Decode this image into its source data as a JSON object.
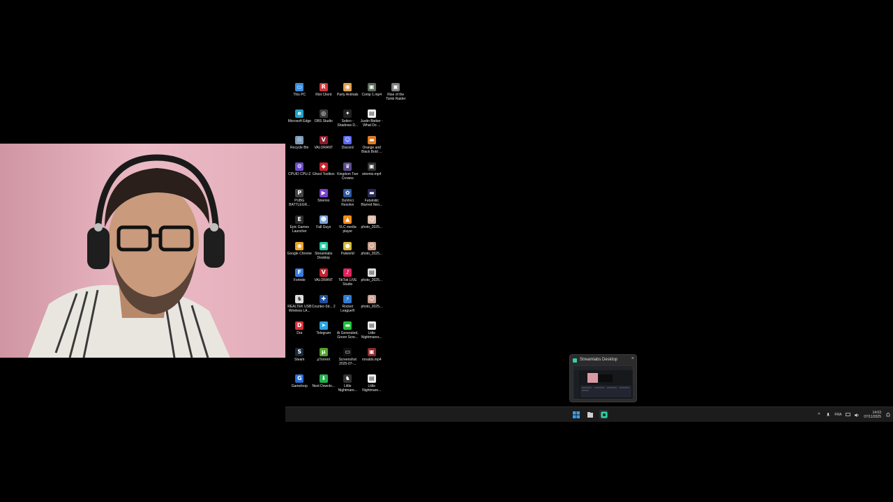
{
  "desktop": {
    "icons": [
      {
        "label": "This PC",
        "color": "#3b8fe0",
        "glyph": "▭"
      },
      {
        "label": "Riot Client",
        "color": "#d13639",
        "glyph": "R"
      },
      {
        "label": "Party Animals",
        "color": "#e0a050",
        "glyph": "◉"
      },
      {
        "label": "Comp 1.mp4",
        "color": "#5a6a5a",
        "glyph": "▣"
      },
      {
        "label": "Rise of the Tomb Raider",
        "color": "#7d7d7d",
        "glyph": "▣"
      },
      {
        "label": "Microsoft Edge",
        "color": "#1fa0c9",
        "glyph": "e"
      },
      {
        "label": "OBS Studio",
        "color": "#3a3a3a",
        "glyph": "◎"
      },
      {
        "label": "Sekiro - Shadows D...",
        "color": "#222",
        "glyph": "✦"
      },
      {
        "label": "Justin Bieber - What Do ...",
        "color": "#eeeeee",
        "glyph": "▤"
      },
      {
        "label": "",
        "color": "transparent",
        "glyph": ""
      },
      {
        "label": "Recycle Bin",
        "color": "#7f9bb8",
        "glyph": "♲"
      },
      {
        "label": "VALORANT",
        "color": "#8b1e2a",
        "glyph": "V"
      },
      {
        "label": "Discord",
        "color": "#5865f2",
        "glyph": "☺"
      },
      {
        "label": "Orange and Black Bold ...",
        "color": "#e07a1f",
        "glyph": "▬"
      },
      {
        "label": "",
        "color": "transparent",
        "glyph": ""
      },
      {
        "label": "CPUID CPU-Z",
        "color": "#6a4cc2",
        "glyph": "⚙"
      },
      {
        "label": "Ghost Toolbox",
        "color": "#c8222c",
        "glyph": "◆"
      },
      {
        "label": "Kingdom Two Crowns",
        "color": "#5a4a8a",
        "glyph": "♛"
      },
      {
        "label": "stremio.mp4",
        "color": "#333",
        "glyph": "▣"
      },
      {
        "label": "",
        "color": "transparent",
        "glyph": ""
      },
      {
        "label": "PUBG BATTLEGR...",
        "color": "#444",
        "glyph": "P"
      },
      {
        "label": "Stremio",
        "color": "#7b3fd1",
        "glyph": "▶"
      },
      {
        "label": "DaVinci Resolve",
        "color": "#2c5aa0",
        "glyph": "✿"
      },
      {
        "label": "Futuristic Blurred Neo...",
        "color": "#2a2a55",
        "glyph": "▬"
      },
      {
        "label": "",
        "color": "transparent",
        "glyph": ""
      },
      {
        "label": "Epic Games Launcher",
        "color": "#2a2a2a",
        "glyph": "E"
      },
      {
        "label": "Fall Guys",
        "color": "#7aa0d8",
        "glyph": "☻"
      },
      {
        "label": "VLC media player",
        "color": "#f28c1e",
        "glyph": "▲"
      },
      {
        "label": "photo_2025...",
        "color": "#d9b9a5",
        "glyph": "☺"
      },
      {
        "label": "",
        "color": "transparent",
        "glyph": ""
      },
      {
        "label": "Google Chrome",
        "color": "#e9a326",
        "glyph": "◉"
      },
      {
        "label": "Streamlabs Desktop",
        "color": "#23c7a0",
        "glyph": "▣"
      },
      {
        "label": "Palworld",
        "color": "#d6b73a",
        "glyph": "●"
      },
      {
        "label": "photo_2025...",
        "color": "#c99b88",
        "glyph": "☺"
      },
      {
        "label": "",
        "color": "transparent",
        "glyph": ""
      },
      {
        "label": "Fortnite",
        "color": "#3a7be0",
        "glyph": "F"
      },
      {
        "label": "VALORANT",
        "color": "#c4232f",
        "glyph": "V"
      },
      {
        "label": "TikTok LIVE Studio",
        "color": "#e0245e",
        "glyph": "♪"
      },
      {
        "label": "photo_2025...",
        "color": "#dddddd",
        "glyph": "▤"
      },
      {
        "label": "",
        "color": "transparent",
        "glyph": ""
      },
      {
        "label": "REALTEK USB Wireless LA...",
        "color": "#dddddd",
        "glyph": "♞"
      },
      {
        "label": "Counter-Str... 2",
        "color": "#1f4f9c",
        "glyph": "✚"
      },
      {
        "label": "Rocket League®",
        "color": "#2f7bd1",
        "glyph": "⚡"
      },
      {
        "label": "photo_2025...",
        "color": "#c79c8c",
        "glyph": "☺"
      },
      {
        "label": "",
        "color": "transparent",
        "glyph": ""
      },
      {
        "label": "Dra",
        "color": "#d8323a",
        "glyph": "D"
      },
      {
        "label": "Telegram",
        "color": "#2aa3e0",
        "glyph": "➤"
      },
      {
        "label": "Ai Generated, Green Scre...",
        "color": "#1fbf3a",
        "glyph": "▬"
      },
      {
        "label": "Little Nightmares...",
        "color": "#eeeeee",
        "glyph": "▤"
      },
      {
        "label": "",
        "color": "transparent",
        "glyph": ""
      },
      {
        "label": "Steam",
        "color": "#1b2838",
        "glyph": "S"
      },
      {
        "label": "µTorrent",
        "color": "#4fa52a",
        "glyph": "µ"
      },
      {
        "label": "Screenshot 2025-07-...",
        "color": "#111",
        "glyph": "▭"
      },
      {
        "label": "ronaldo.mp4",
        "color": "#8a2a2a",
        "glyph": "▣"
      },
      {
        "label": "",
        "color": "transparent",
        "glyph": ""
      },
      {
        "label": "Gameloop",
        "color": "#2a6fd8",
        "glyph": "G"
      },
      {
        "label": "Next Downlo...",
        "color": "#22b04a",
        "glyph": "⬇"
      },
      {
        "label": "Little Nightmare...",
        "color": "#333",
        "glyph": "♞"
      },
      {
        "label": "Little Nightmare...",
        "color": "#eeeeee",
        "glyph": "▤"
      },
      {
        "label": "",
        "color": "transparent",
        "glyph": ""
      }
    ]
  },
  "thumbnail": {
    "title": "Streamlabs Desktop",
    "close_glyph": "×"
  },
  "taskbar": {
    "start_glyph": "⊞",
    "tray": {
      "chevron": "^",
      "language": "FRA",
      "time": "14:03",
      "date": "07/11/2025"
    }
  }
}
